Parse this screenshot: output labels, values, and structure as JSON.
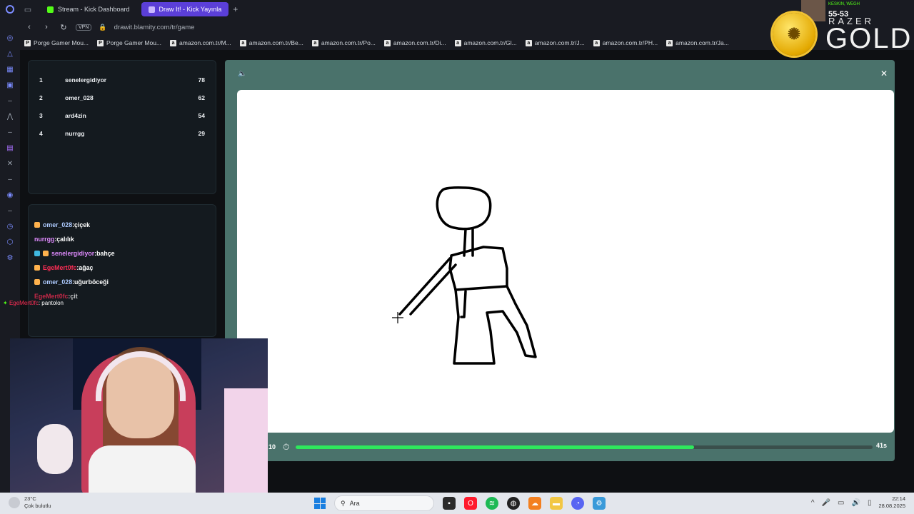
{
  "browser": {
    "tabs": [
      {
        "label": "Stream - Kick Dashboard",
        "active": false
      },
      {
        "label": "Draw It! - Kick Yayınla",
        "active": true
      }
    ],
    "address": "drawit.blamity.com/tr/game",
    "vpn_label": "VPN",
    "bookmarks": [
      "Porge Gamer Mou...",
      "Porge Gamer Mou...",
      "amazon.com.tr/M...",
      "amazon.com.tr/Be...",
      "amazon.com.tr/Po...",
      "amazon.com.tr/Di...",
      "amazon.com.tr/Gl...",
      "amazon.com.tr/J...",
      "amazon.com.tr/PH...",
      "amazon.com.tr/Ja..."
    ]
  },
  "scoreboard": [
    {
      "rank": "1",
      "name": "senelergidiyor",
      "points": "78"
    },
    {
      "rank": "2",
      "name": "omer_028",
      "points": "62"
    },
    {
      "rank": "3",
      "name": "ard4zin",
      "points": "54"
    },
    {
      "rank": "4",
      "name": "nurrgg",
      "points": "29"
    }
  ],
  "chat": [
    {
      "user": "omer_028",
      "message": ":çiçek",
      "color": "blue"
    },
    {
      "user": "nurrgg",
      "message": ":çalılık",
      "color": "pink"
    },
    {
      "user": "senelergidiyor",
      "message": ":bahçe",
      "color": "pink"
    },
    {
      "user": "EgeMert0fc",
      "message": ":ağaç",
      "color": "red"
    },
    {
      "user": "omer_028",
      "message": ":uğurböceği",
      "color": "blue"
    },
    {
      "user": "EgeMert0fc",
      "message": ":çit",
      "color": "red"
    }
  ],
  "overlay_chat": {
    "user": "EgeMert0fc",
    "message": ": pantolon"
  },
  "game": {
    "round": "10",
    "time_left": "41s",
    "progress": 0.69
  },
  "stream_overlay": {
    "score_title": "KESKIN, WEGH",
    "score": "55-53",
    "brand_line": "RAZER",
    "brand_big": "GOLD"
  },
  "taskbar": {
    "weather_temp": "23°C",
    "weather_desc": "Çok bulutlu",
    "search_placeholder": "Ara",
    "time": "22:14",
    "date": "28.08.2025"
  },
  "colors": {
    "accent": "#5b3fd8",
    "kick_green": "#53fc18",
    "progress": "#2ee85c",
    "panel": "#4a726b"
  }
}
